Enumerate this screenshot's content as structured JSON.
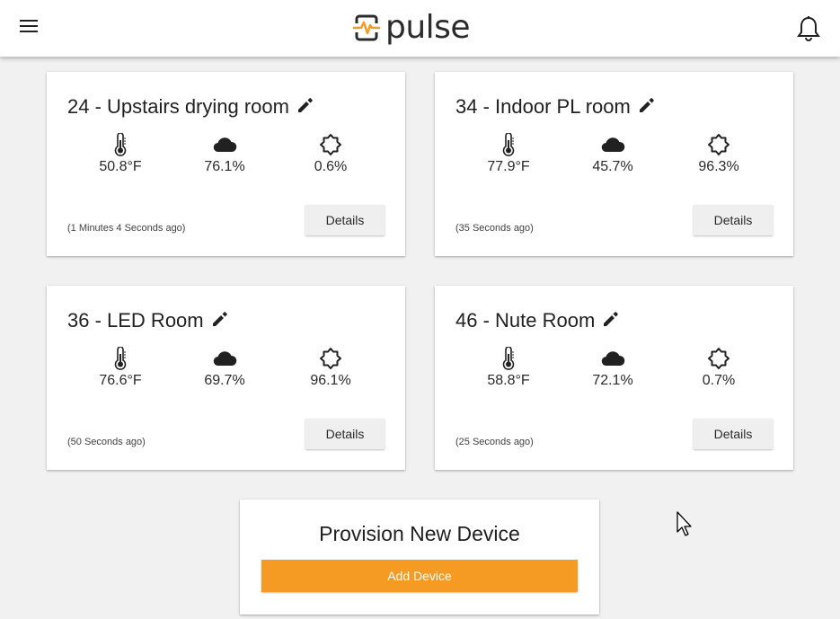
{
  "header": {
    "logo_text": "pulse",
    "brand_color": "#f59a23",
    "menu_icon": "hamburger-menu-icon",
    "notification_icon": "bell-icon"
  },
  "devices": [
    {
      "title": "24 - Upstairs drying room",
      "temperature": "50.8°F",
      "humidity": "76.1%",
      "light": "0.6%",
      "updated": "(1 Minutes 4 Seconds ago)",
      "details_label": "Details"
    },
    {
      "title": "34 - Indoor PL room",
      "temperature": "77.9°F",
      "humidity": "45.7%",
      "light": "96.3%",
      "updated": "(35 Seconds ago)",
      "details_label": "Details"
    },
    {
      "title": "36 - LED Room",
      "temperature": "76.6°F",
      "humidity": "69.7%",
      "light": "96.1%",
      "updated": "(50 Seconds ago)",
      "details_label": "Details"
    },
    {
      "title": "46 - Nute Room",
      "temperature": "58.8°F",
      "humidity": "72.1%",
      "light": "0.7%",
      "updated": "(25 Seconds ago)",
      "details_label": "Details"
    }
  ],
  "provision": {
    "title": "Provision New Device",
    "add_label": "Add Device"
  }
}
